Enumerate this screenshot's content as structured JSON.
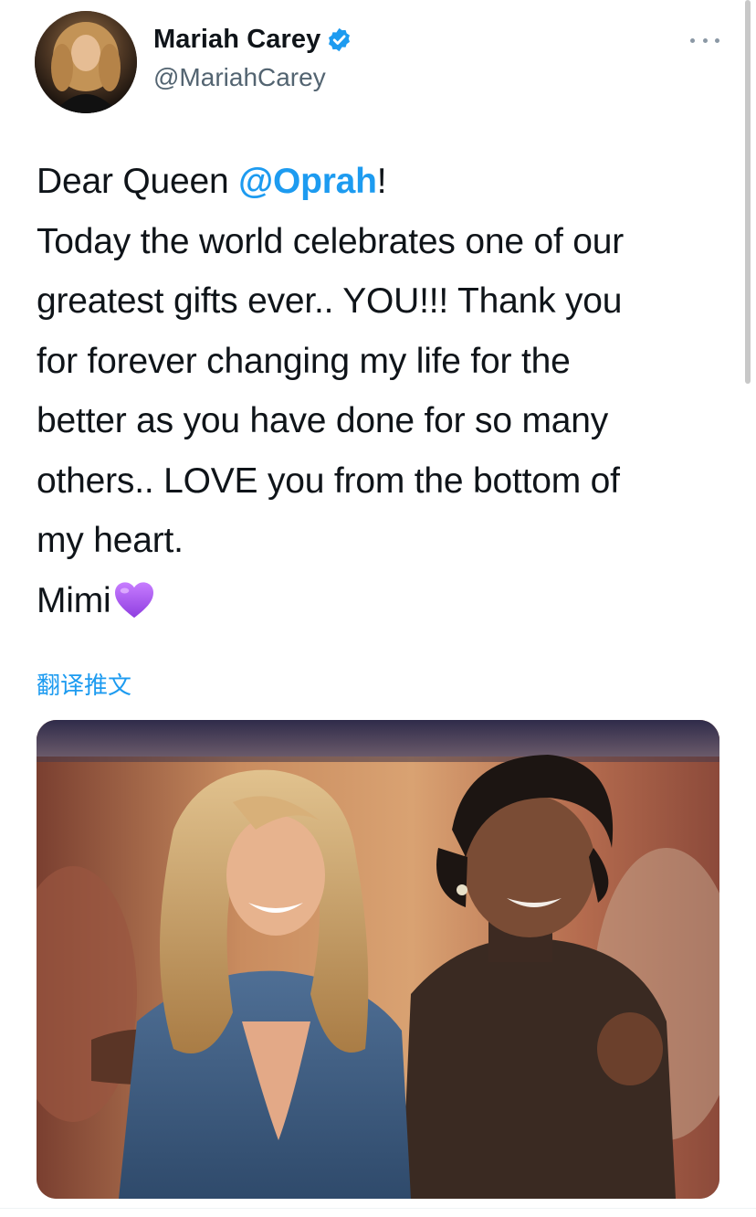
{
  "author": {
    "display_name": "Mariah Carey",
    "handle": "@MariahCarey",
    "verified_icon": "verified-badge-icon",
    "verified_color": "#1d9bf0"
  },
  "tweet": {
    "lines": [
      {
        "before": "Dear Queen ",
        "mention": "@Oprah",
        "after": "!"
      },
      {
        "text": "Today the world celebrates one of our"
      },
      {
        "text": "greatest gifts ever.. YOU!!! Thank you"
      },
      {
        "text": "for forever changing my life for the"
      },
      {
        "text": "better as you have done for so many"
      },
      {
        "text": "others.. LOVE you from the bottom of"
      },
      {
        "text": "my heart."
      },
      {
        "text": "Mimi",
        "emoji": "purple-heart-icon"
      }
    ],
    "mention_color": "#1d9bf0"
  },
  "translate_label": "翻译推文",
  "menu_icon": "more-options-icon",
  "media": {
    "kind": "photo",
    "icon": "photo-image"
  }
}
